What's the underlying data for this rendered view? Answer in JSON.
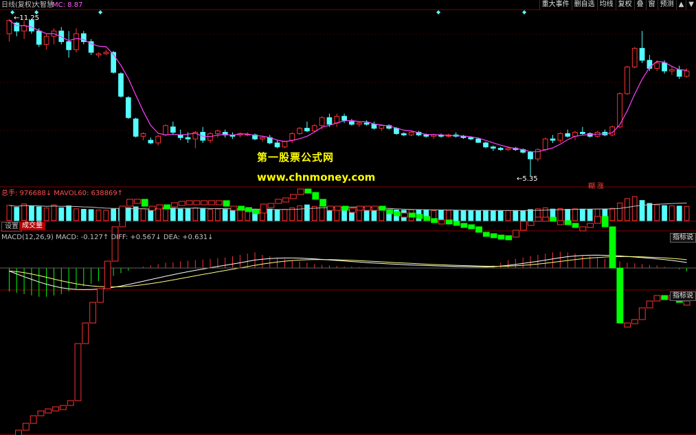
{
  "header": {
    "title": "日线(复权)",
    "indicator": "大智慧",
    "mc": "MC: 8.87"
  },
  "toolbar": [
    {
      "label": "重大事件",
      "name": "major-events-button"
    },
    {
      "label": "删自选",
      "name": "remove-watchlist-button"
    },
    {
      "label": "均线",
      "name": "moving-average-button"
    },
    {
      "label": "复权",
      "name": "adjust-button"
    },
    {
      "label": "叠",
      "name": "overlay-button"
    },
    {
      "label": "窗",
      "name": "window-button"
    },
    {
      "label": "预测",
      "name": "forecast-button"
    }
  ],
  "price_marks": {
    "high": "11.25",
    "low": "5.35"
  },
  "price_tag": "糊 涨",
  "watermark": {
    "line1": "第一股票公式网",
    "line2": "www.chnmoney.com"
  },
  "volume_label": "总手: 976688↓ MAVOL60: 638869↑",
  "volume_tabs": {
    "settings": "设置",
    "volume": "成交量"
  },
  "macd_label": "MACD(12,26,9) MACD: -0.127↑ DIFF: +0.567↓ DEA: +0.631↓",
  "indicator_button": "指标说",
  "colors": {
    "up": "#ff3232",
    "down": "#54ffff",
    "ma": "#ff40ff",
    "lower_up": "#ff3232",
    "lower_down": "#00ff00"
  },
  "chart_data": {
    "type": "candlestick",
    "price_range": [
      5.0,
      11.5
    ],
    "candles": [
      [
        10.7,
        11.25,
        10.4,
        11.2
      ],
      [
        11.1,
        11.15,
        10.6,
        10.8
      ],
      [
        10.8,
        11.2,
        10.5,
        11.0
      ],
      [
        11.2,
        11.25,
        10.7,
        10.8
      ],
      [
        10.8,
        10.9,
        10.2,
        10.3
      ],
      [
        10.3,
        10.7,
        10.1,
        10.6
      ],
      [
        10.6,
        10.9,
        10.3,
        10.8
      ],
      [
        10.8,
        10.95,
        10.3,
        10.4
      ],
      [
        10.4,
        10.8,
        9.8,
        10.1
      ],
      [
        10.1,
        10.9,
        10.0,
        10.7
      ],
      [
        10.7,
        10.8,
        10.3,
        10.4
      ],
      [
        10.4,
        10.5,
        9.9,
        10.0
      ],
      [
        9.9,
        10.0,
        9.8,
        9.95
      ],
      [
        9.95,
        10.1,
        9.9,
        10.0
      ],
      [
        10.0,
        10.05,
        9.2,
        9.25
      ],
      [
        9.2,
        9.25,
        8.3,
        8.35
      ],
      [
        8.3,
        8.35,
        7.5,
        7.55
      ],
      [
        7.5,
        7.55,
        6.8,
        6.85
      ],
      [
        6.85,
        7.0,
        6.7,
        6.95
      ],
      [
        6.7,
        6.8,
        6.55,
        6.6
      ],
      [
        6.6,
        6.9,
        6.5,
        6.85
      ],
      [
        6.9,
        7.3,
        6.85,
        7.25
      ],
      [
        7.2,
        7.4,
        6.9,
        7.0
      ],
      [
        6.9,
        7.1,
        6.7,
        6.8
      ],
      [
        6.8,
        7.0,
        6.6,
        6.75
      ],
      [
        6.75,
        7.05,
        6.4,
        7.0
      ],
      [
        7.0,
        7.2,
        6.6,
        6.7
      ],
      [
        6.7,
        7.0,
        6.6,
        6.95
      ],
      [
        6.95,
        7.1,
        6.8,
        7.05
      ],
      [
        7.0,
        7.1,
        6.8,
        6.9
      ],
      [
        6.9,
        7.0,
        6.75,
        6.85
      ],
      [
        6.9,
        7.0,
        6.8,
        6.95
      ],
      [
        6.9,
        7.0,
        6.85,
        6.92
      ],
      [
        6.9,
        6.95,
        6.7,
        6.75
      ],
      [
        6.75,
        6.85,
        6.65,
        6.8
      ],
      [
        6.8,
        6.9,
        6.55,
        6.6
      ],
      [
        6.6,
        6.7,
        6.4,
        6.45
      ],
      [
        6.45,
        6.7,
        6.4,
        6.65
      ],
      [
        6.7,
        7.0,
        6.6,
        6.95
      ],
      [
        6.95,
        7.2,
        6.9,
        7.15
      ],
      [
        7.15,
        7.4,
        7.0,
        7.05
      ],
      [
        7.05,
        7.3,
        7.0,
        7.25
      ],
      [
        7.25,
        7.6,
        7.1,
        7.55
      ],
      [
        7.55,
        7.7,
        7.2,
        7.3
      ],
      [
        7.35,
        7.7,
        7.2,
        7.6
      ],
      [
        7.6,
        7.7,
        7.35,
        7.45
      ],
      [
        7.4,
        7.5,
        7.25,
        7.3
      ],
      [
        7.3,
        7.4,
        7.2,
        7.35
      ],
      [
        7.35,
        7.45,
        7.25,
        7.3
      ],
      [
        7.3,
        7.4,
        7.1,
        7.15
      ],
      [
        7.15,
        7.3,
        7.05,
        7.25
      ],
      [
        7.25,
        7.3,
        7.1,
        7.15
      ],
      [
        7.15,
        7.2,
        6.9,
        6.95
      ],
      [
        6.95,
        7.0,
        6.85,
        6.9
      ],
      [
        6.9,
        7.05,
        6.85,
        7.0
      ],
      [
        7.0,
        7.05,
        6.85,
        6.9
      ],
      [
        6.9,
        6.95,
        6.8,
        6.85
      ],
      [
        6.85,
        6.95,
        6.75,
        6.9
      ],
      [
        6.9,
        6.95,
        6.8,
        6.85
      ],
      [
        6.85,
        6.95,
        6.8,
        6.9
      ],
      [
        6.9,
        7.0,
        6.8,
        6.85
      ],
      [
        6.85,
        6.9,
        6.75,
        6.8
      ],
      [
        6.8,
        6.85,
        6.7,
        6.75
      ],
      [
        6.75,
        6.8,
        6.6,
        6.62
      ],
      [
        6.6,
        6.65,
        6.4,
        6.45
      ],
      [
        6.45,
        6.5,
        6.3,
        6.4
      ],
      [
        6.4,
        6.45,
        6.3,
        6.35
      ],
      [
        6.35,
        6.45,
        6.3,
        6.4
      ],
      [
        6.4,
        6.45,
        6.3,
        6.35
      ],
      [
        6.35,
        6.4,
        6.2,
        6.25
      ],
      [
        6.25,
        6.3,
        5.35,
        6.0
      ],
      [
        6.0,
        6.4,
        5.9,
        6.35
      ],
      [
        6.35,
        6.8,
        6.3,
        6.75
      ],
      [
        6.75,
        6.9,
        6.6,
        6.7
      ],
      [
        6.7,
        7.0,
        6.6,
        6.95
      ],
      [
        6.95,
        7.1,
        6.8,
        6.85
      ],
      [
        6.85,
        7.05,
        6.7,
        7.0
      ],
      [
        7.0,
        7.2,
        6.9,
        6.95
      ],
      [
        6.95,
        7.0,
        6.8,
        6.85
      ],
      [
        6.85,
        7.05,
        6.8,
        7.0
      ],
      [
        7.0,
        7.1,
        6.85,
        6.9
      ],
      [
        6.9,
        7.25,
        6.85,
        7.2
      ],
      [
        7.2,
        8.5,
        7.15,
        8.45
      ],
      [
        8.45,
        9.5,
        8.4,
        9.45
      ],
      [
        9.45,
        10.2,
        9.4,
        10.15
      ],
      [
        10.15,
        10.8,
        9.6,
        9.7
      ],
      [
        9.7,
        9.9,
        9.3,
        9.4
      ],
      [
        9.4,
        9.7,
        9.3,
        9.6
      ],
      [
        9.6,
        9.7,
        9.2,
        9.3
      ],
      [
        9.3,
        9.45,
        9.15,
        9.35
      ],
      [
        9.35,
        9.5,
        9.0,
        9.1
      ],
      [
        9.1,
        9.4,
        9.05,
        9.3
      ]
    ],
    "volume": [
      620,
      540,
      680,
      590,
      560,
      510,
      640,
      520,
      600,
      480,
      460,
      450,
      430,
      420,
      470,
      500,
      520,
      560,
      490,
      470,
      500,
      540,
      510,
      470,
      480,
      520,
      490,
      460,
      470,
      455,
      440,
      460,
      450,
      445,
      430,
      470,
      440,
      460,
      520,
      600,
      640,
      580,
      620,
      560,
      540,
      500,
      470,
      480,
      460,
      440,
      470,
      450,
      430,
      420,
      440,
      430,
      420,
      410,
      430,
      420,
      415,
      410,
      405,
      400,
      420,
      410,
      400,
      405,
      410,
      400,
      450,
      480,
      520,
      470,
      490,
      460,
      480,
      470,
      450,
      470,
      460,
      500,
      720,
      900,
      980,
      820,
      700,
      640,
      610,
      600,
      590,
      580
    ],
    "macd_hist": [
      -0.9,
      -0.95,
      -1.0,
      -1.05,
      -1.1,
      -1.1,
      -1.05,
      -1.0,
      -0.9,
      -0.8,
      -0.7,
      -0.6,
      -0.5,
      -0.4,
      -0.3,
      -0.2,
      -0.1,
      0.0,
      0.05,
      0.1,
      0.15,
      0.2,
      0.22,
      0.25,
      0.28,
      0.3,
      0.32,
      0.35,
      0.38,
      0.4,
      0.45,
      0.5,
      0.55,
      0.6,
      0.5,
      0.45,
      0.4,
      0.35,
      0.3,
      0.25,
      0.2,
      0.15,
      0.12,
      0.1,
      0.08,
      0.06,
      0.05,
      0.04,
      0.03,
      0.02,
      0.02,
      0.01,
      0.01,
      0.0,
      0.0,
      0.0,
      0.0,
      0.0,
      0.0,
      0.0,
      0.0,
      0.0,
      0.0,
      0.0,
      0.0,
      0.1,
      0.2,
      0.3,
      0.35,
      0.4,
      0.45,
      0.5,
      0.55,
      0.6,
      0.62,
      0.6,
      0.55,
      0.5,
      0.45,
      0.4,
      0.35,
      0.3,
      0.25,
      0.2,
      0.18,
      0.15,
      0.12,
      0.1,
      0.05,
      0.0,
      -0.05,
      -0.127
    ],
    "lower_path": [
      640,
      635,
      626,
      616,
      605,
      598,
      595,
      592,
      590,
      583,
      500,
      470,
      440,
      420,
      380,
      330,
      300,
      290,
      290,
      300,
      300,
      298,
      300,
      295,
      293,
      292,
      292,
      292,
      292,
      292,
      300,
      300,
      302,
      305,
      310,
      297,
      296,
      290,
      288,
      283,
      275,
      280,
      290,
      300,
      300,
      300,
      303,
      303,
      300,
      300,
      300,
      305,
      308,
      310,
      310,
      312,
      315,
      318,
      320,
      320,
      322,
      325,
      327,
      330,
      338,
      340,
      342,
      343,
      345,
      335,
      322,
      322,
      316,
      316,
      322,
      321,
      325,
      331,
      330,
      325,
      315,
      330,
      390,
      470,
      470,
      465,
      448,
      438,
      430,
      435,
      430,
      440,
      438
    ]
  }
}
